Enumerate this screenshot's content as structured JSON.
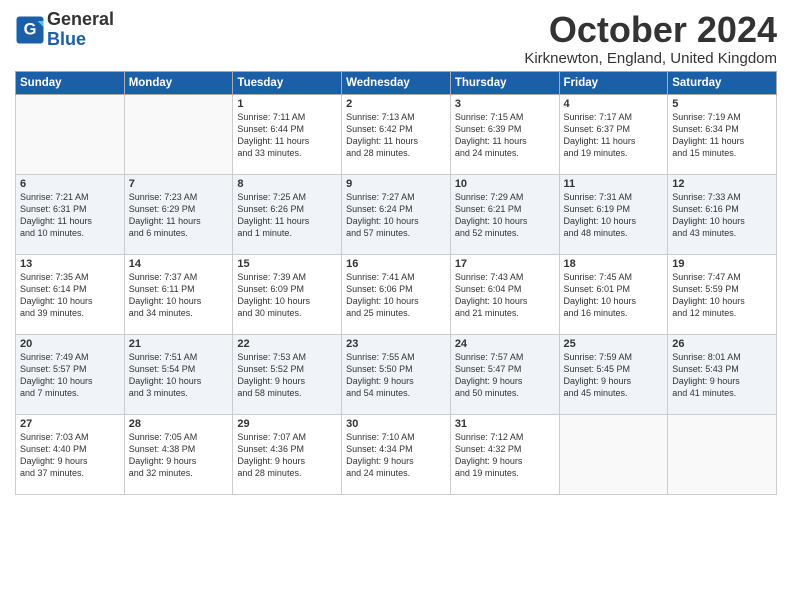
{
  "header": {
    "logo_line1": "General",
    "logo_line2": "Blue",
    "month_title": "October 2024",
    "location": "Kirknewton, England, United Kingdom"
  },
  "days_of_week": [
    "Sunday",
    "Monday",
    "Tuesday",
    "Wednesday",
    "Thursday",
    "Friday",
    "Saturday"
  ],
  "weeks": [
    [
      {
        "day": "",
        "info": ""
      },
      {
        "day": "",
        "info": ""
      },
      {
        "day": "1",
        "info": "Sunrise: 7:11 AM\nSunset: 6:44 PM\nDaylight: 11 hours\nand 33 minutes."
      },
      {
        "day": "2",
        "info": "Sunrise: 7:13 AM\nSunset: 6:42 PM\nDaylight: 11 hours\nand 28 minutes."
      },
      {
        "day": "3",
        "info": "Sunrise: 7:15 AM\nSunset: 6:39 PM\nDaylight: 11 hours\nand 24 minutes."
      },
      {
        "day": "4",
        "info": "Sunrise: 7:17 AM\nSunset: 6:37 PM\nDaylight: 11 hours\nand 19 minutes."
      },
      {
        "day": "5",
        "info": "Sunrise: 7:19 AM\nSunset: 6:34 PM\nDaylight: 11 hours\nand 15 minutes."
      }
    ],
    [
      {
        "day": "6",
        "info": "Sunrise: 7:21 AM\nSunset: 6:31 PM\nDaylight: 11 hours\nand 10 minutes."
      },
      {
        "day": "7",
        "info": "Sunrise: 7:23 AM\nSunset: 6:29 PM\nDaylight: 11 hours\nand 6 minutes."
      },
      {
        "day": "8",
        "info": "Sunrise: 7:25 AM\nSunset: 6:26 PM\nDaylight: 11 hours\nand 1 minute."
      },
      {
        "day": "9",
        "info": "Sunrise: 7:27 AM\nSunset: 6:24 PM\nDaylight: 10 hours\nand 57 minutes."
      },
      {
        "day": "10",
        "info": "Sunrise: 7:29 AM\nSunset: 6:21 PM\nDaylight: 10 hours\nand 52 minutes."
      },
      {
        "day": "11",
        "info": "Sunrise: 7:31 AM\nSunset: 6:19 PM\nDaylight: 10 hours\nand 48 minutes."
      },
      {
        "day": "12",
        "info": "Sunrise: 7:33 AM\nSunset: 6:16 PM\nDaylight: 10 hours\nand 43 minutes."
      }
    ],
    [
      {
        "day": "13",
        "info": "Sunrise: 7:35 AM\nSunset: 6:14 PM\nDaylight: 10 hours\nand 39 minutes."
      },
      {
        "day": "14",
        "info": "Sunrise: 7:37 AM\nSunset: 6:11 PM\nDaylight: 10 hours\nand 34 minutes."
      },
      {
        "day": "15",
        "info": "Sunrise: 7:39 AM\nSunset: 6:09 PM\nDaylight: 10 hours\nand 30 minutes."
      },
      {
        "day": "16",
        "info": "Sunrise: 7:41 AM\nSunset: 6:06 PM\nDaylight: 10 hours\nand 25 minutes."
      },
      {
        "day": "17",
        "info": "Sunrise: 7:43 AM\nSunset: 6:04 PM\nDaylight: 10 hours\nand 21 minutes."
      },
      {
        "day": "18",
        "info": "Sunrise: 7:45 AM\nSunset: 6:01 PM\nDaylight: 10 hours\nand 16 minutes."
      },
      {
        "day": "19",
        "info": "Sunrise: 7:47 AM\nSunset: 5:59 PM\nDaylight: 10 hours\nand 12 minutes."
      }
    ],
    [
      {
        "day": "20",
        "info": "Sunrise: 7:49 AM\nSunset: 5:57 PM\nDaylight: 10 hours\nand 7 minutes."
      },
      {
        "day": "21",
        "info": "Sunrise: 7:51 AM\nSunset: 5:54 PM\nDaylight: 10 hours\nand 3 minutes."
      },
      {
        "day": "22",
        "info": "Sunrise: 7:53 AM\nSunset: 5:52 PM\nDaylight: 9 hours\nand 58 minutes."
      },
      {
        "day": "23",
        "info": "Sunrise: 7:55 AM\nSunset: 5:50 PM\nDaylight: 9 hours\nand 54 minutes."
      },
      {
        "day": "24",
        "info": "Sunrise: 7:57 AM\nSunset: 5:47 PM\nDaylight: 9 hours\nand 50 minutes."
      },
      {
        "day": "25",
        "info": "Sunrise: 7:59 AM\nSunset: 5:45 PM\nDaylight: 9 hours\nand 45 minutes."
      },
      {
        "day": "26",
        "info": "Sunrise: 8:01 AM\nSunset: 5:43 PM\nDaylight: 9 hours\nand 41 minutes."
      }
    ],
    [
      {
        "day": "27",
        "info": "Sunrise: 7:03 AM\nSunset: 4:40 PM\nDaylight: 9 hours\nand 37 minutes."
      },
      {
        "day": "28",
        "info": "Sunrise: 7:05 AM\nSunset: 4:38 PM\nDaylight: 9 hours\nand 32 minutes."
      },
      {
        "day": "29",
        "info": "Sunrise: 7:07 AM\nSunset: 4:36 PM\nDaylight: 9 hours\nand 28 minutes."
      },
      {
        "day": "30",
        "info": "Sunrise: 7:10 AM\nSunset: 4:34 PM\nDaylight: 9 hours\nand 24 minutes."
      },
      {
        "day": "31",
        "info": "Sunrise: 7:12 AM\nSunset: 4:32 PM\nDaylight: 9 hours\nand 19 minutes."
      },
      {
        "day": "",
        "info": ""
      },
      {
        "day": "",
        "info": ""
      }
    ]
  ]
}
